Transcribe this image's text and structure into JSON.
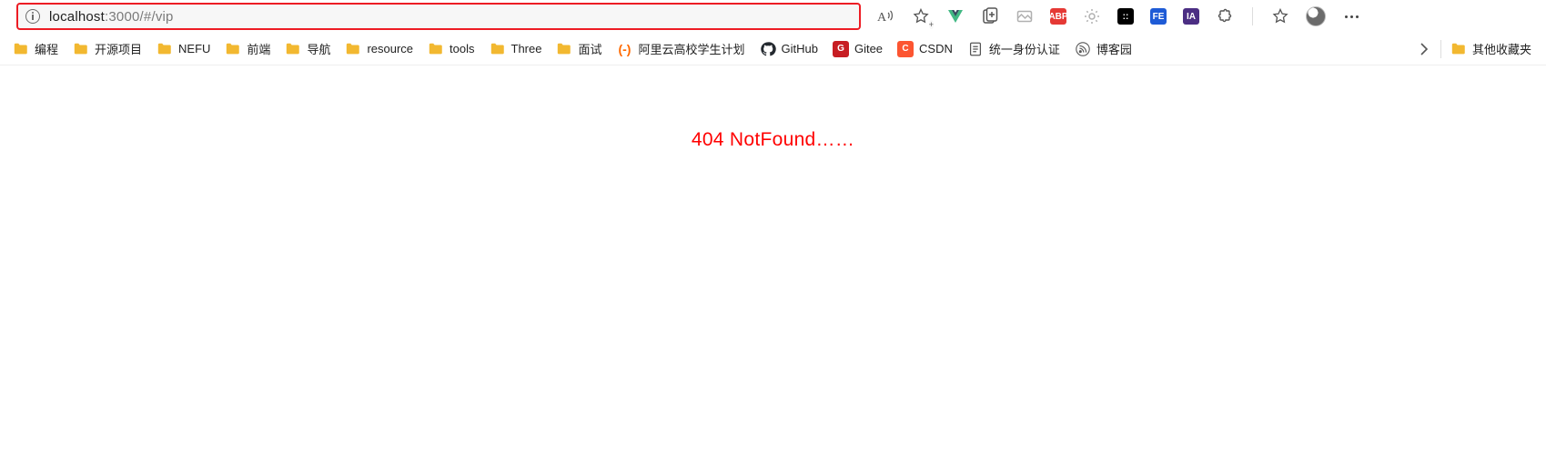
{
  "address_bar": {
    "url_host": "localhost",
    "url_rest": ":3000/#/vip"
  },
  "toolbar_icons": {
    "read_aloud": "A))",
    "favorite": "star",
    "vue": "vue",
    "collections": "collections",
    "screenshot": "screenshot",
    "adblock": "ABP",
    "radar": "radar",
    "darkdots": "dots",
    "fe": "FE",
    "ia": "IA",
    "extensions": "ext",
    "favorites": "fav",
    "profile": "profile",
    "menu": "⋯"
  },
  "bookmarks": [
    {
      "type": "folder",
      "label": "编程"
    },
    {
      "type": "folder",
      "label": "开源项目"
    },
    {
      "type": "folder",
      "label": "NEFU"
    },
    {
      "type": "folder",
      "label": "前端"
    },
    {
      "type": "folder",
      "label": "导航"
    },
    {
      "type": "folder",
      "label": "resource"
    },
    {
      "type": "folder",
      "label": "tools"
    },
    {
      "type": "folder",
      "label": "Three"
    },
    {
      "type": "folder",
      "label": "面试"
    },
    {
      "type": "ali",
      "label": "阿里云高校学生计划"
    },
    {
      "type": "github",
      "label": "GitHub"
    },
    {
      "type": "gitee",
      "label": "Gitee"
    },
    {
      "type": "csdn",
      "label": "CSDN"
    },
    {
      "type": "doc",
      "label": "统一身份认证"
    },
    {
      "type": "cnblogs",
      "label": "博客园"
    }
  ],
  "bookmarks_overflow": {
    "label": "其他收藏夹"
  },
  "page": {
    "not_found": "404 NotFound……"
  }
}
